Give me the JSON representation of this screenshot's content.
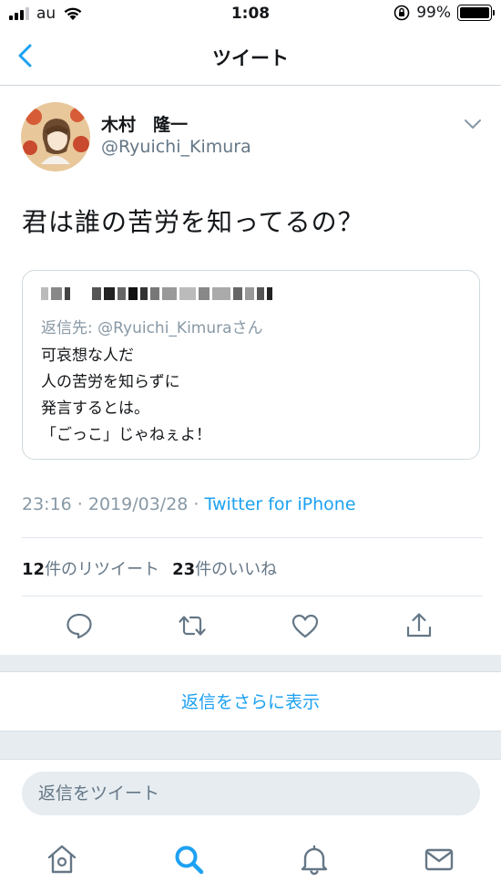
{
  "status_bar": {
    "carrier": "au",
    "time": "1:08",
    "battery": "99%",
    "battery_level": 0.99
  },
  "nav": {
    "title": "ツイート",
    "back_icon": "chevron-left-icon"
  },
  "tweet": {
    "author_name": "木村　隆一",
    "author_handle": "@Ryuichi_Kimura",
    "text": "君は誰の苦労を知ってるの？",
    "timestamp": "23:16 · 2019/03/28 · ",
    "source": "Twitter for iPhone",
    "quoted": {
      "reply_to_prefix": "返信先: ",
      "reply_to_handle": "@Ryuichi_Kimura",
      "reply_to_suffix": "さん",
      "lines": [
        "可哀想な人だ",
        "人の苦労を知らずに",
        "発言するとは。",
        "「ごっこ」じゃねぇよ！"
      ]
    },
    "stats": {
      "retweets_count": "12",
      "retweets_label": "件のリツイート",
      "likes_count": "23",
      "likes_label": "件のいいね"
    }
  },
  "show_more": "返信をさらに表示",
  "reply_placeholder": "返信をツイート",
  "colors": {
    "accent": "#1da1f2",
    "muted": "#657786",
    "border": "#e1e8ed"
  }
}
